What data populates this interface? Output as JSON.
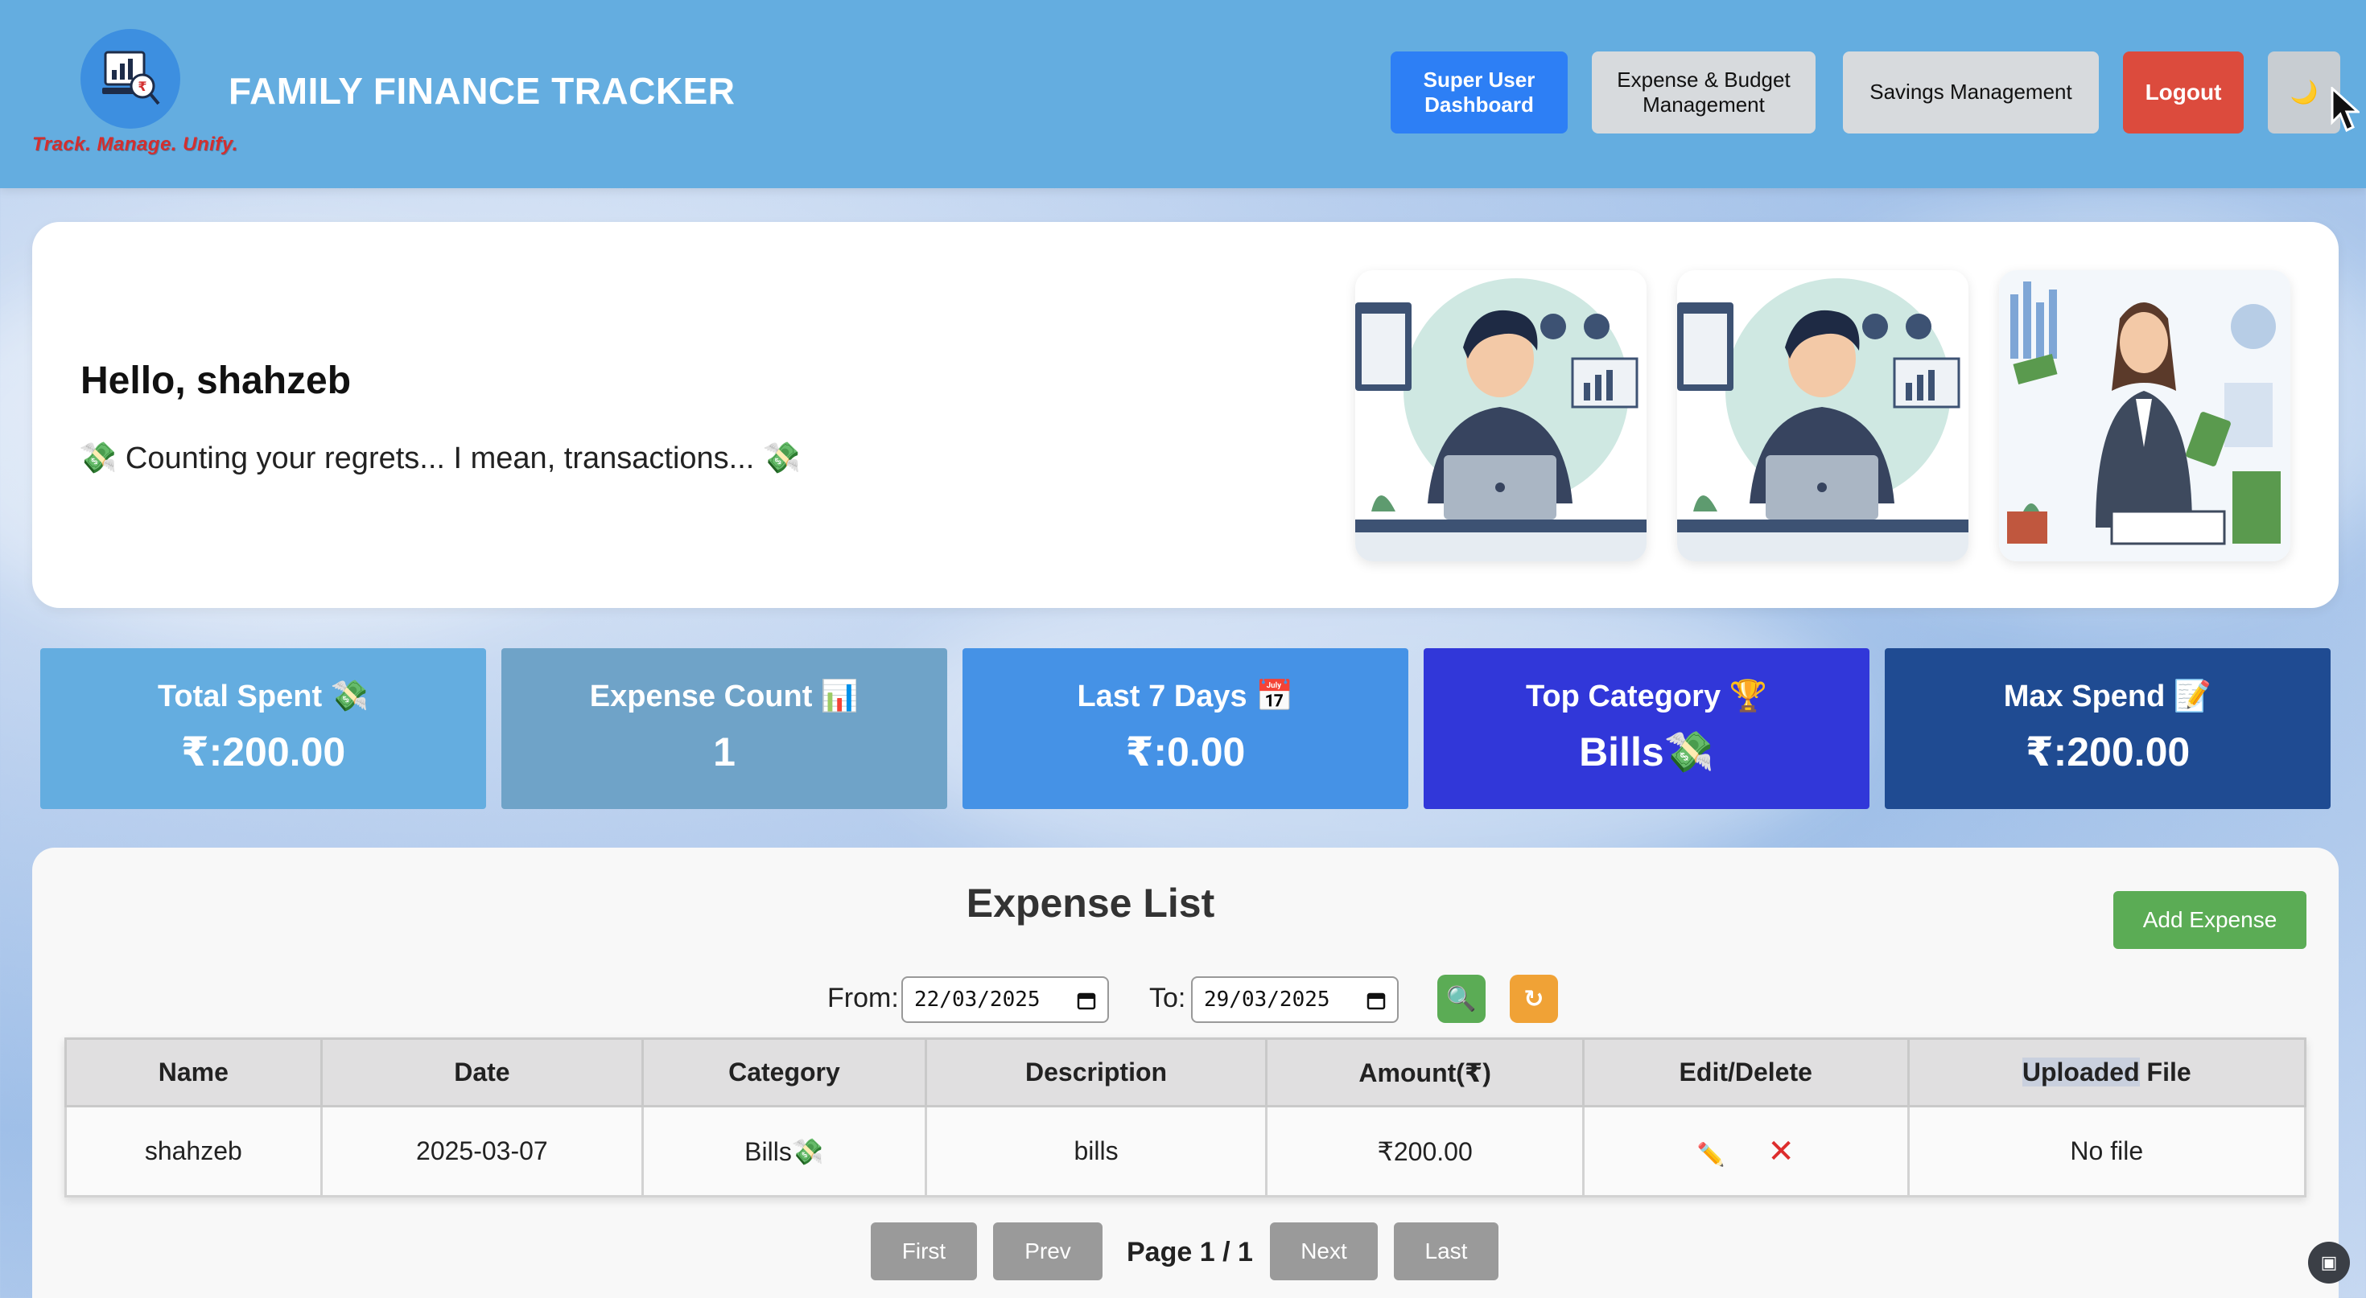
{
  "header": {
    "title": "FAMILY FINANCE TRACKER",
    "tagline": "Track. Manage. Unify.",
    "nav": {
      "super_user": "Super User Dashboard",
      "expense_budget": "Expense & Budget Management",
      "savings": "Savings Management",
      "logout": "Logout",
      "theme_toggle": "🌙"
    }
  },
  "hero": {
    "greeting": "Hello, shahzeb",
    "quip": "💸 Counting your regrets... I mean, transactions... 💸"
  },
  "stats": [
    {
      "label": "Total Spent 💸",
      "value": "₹:200.00",
      "color": "#64ade0"
    },
    {
      "label": "Expense Count 📊",
      "value": "1",
      "color": "#6fa3c8"
    },
    {
      "label": "Last 7 Days 📅",
      "value": "₹:0.00",
      "color": "#4592e6"
    },
    {
      "label": "Top Category 🏆",
      "value": "Bills💸",
      "color": "#3137d9"
    },
    {
      "label": "Max Spend 📝",
      "value": "₹:200.00",
      "color": "#1f4b92"
    }
  ],
  "expense_list": {
    "title": "Expense List",
    "add_button": "Add Expense",
    "filter": {
      "from_label": "From:",
      "from_value": "22/03/2025",
      "to_label": "To:",
      "to_value": "29/03/2025",
      "search_icon": "🔍",
      "reset_icon": "↻"
    },
    "columns": [
      "Name",
      "Date",
      "Category",
      "Description",
      "Amount(₹)",
      "Edit/Delete"
    ],
    "file_column": {
      "highlighted": "Uploaded",
      "rest": " File"
    },
    "rows": [
      {
        "name": "shahzeb",
        "date": "2025-03-07",
        "category": "Bills💸",
        "description": "bills",
        "amount": "₹200.00",
        "edit_icon": "✏️",
        "delete_icon": "✕",
        "file": "No file"
      }
    ]
  },
  "pagination": {
    "first": "First",
    "prev": "Prev",
    "label": "Page 1 / 1",
    "next": "Next",
    "last": "Last"
  }
}
